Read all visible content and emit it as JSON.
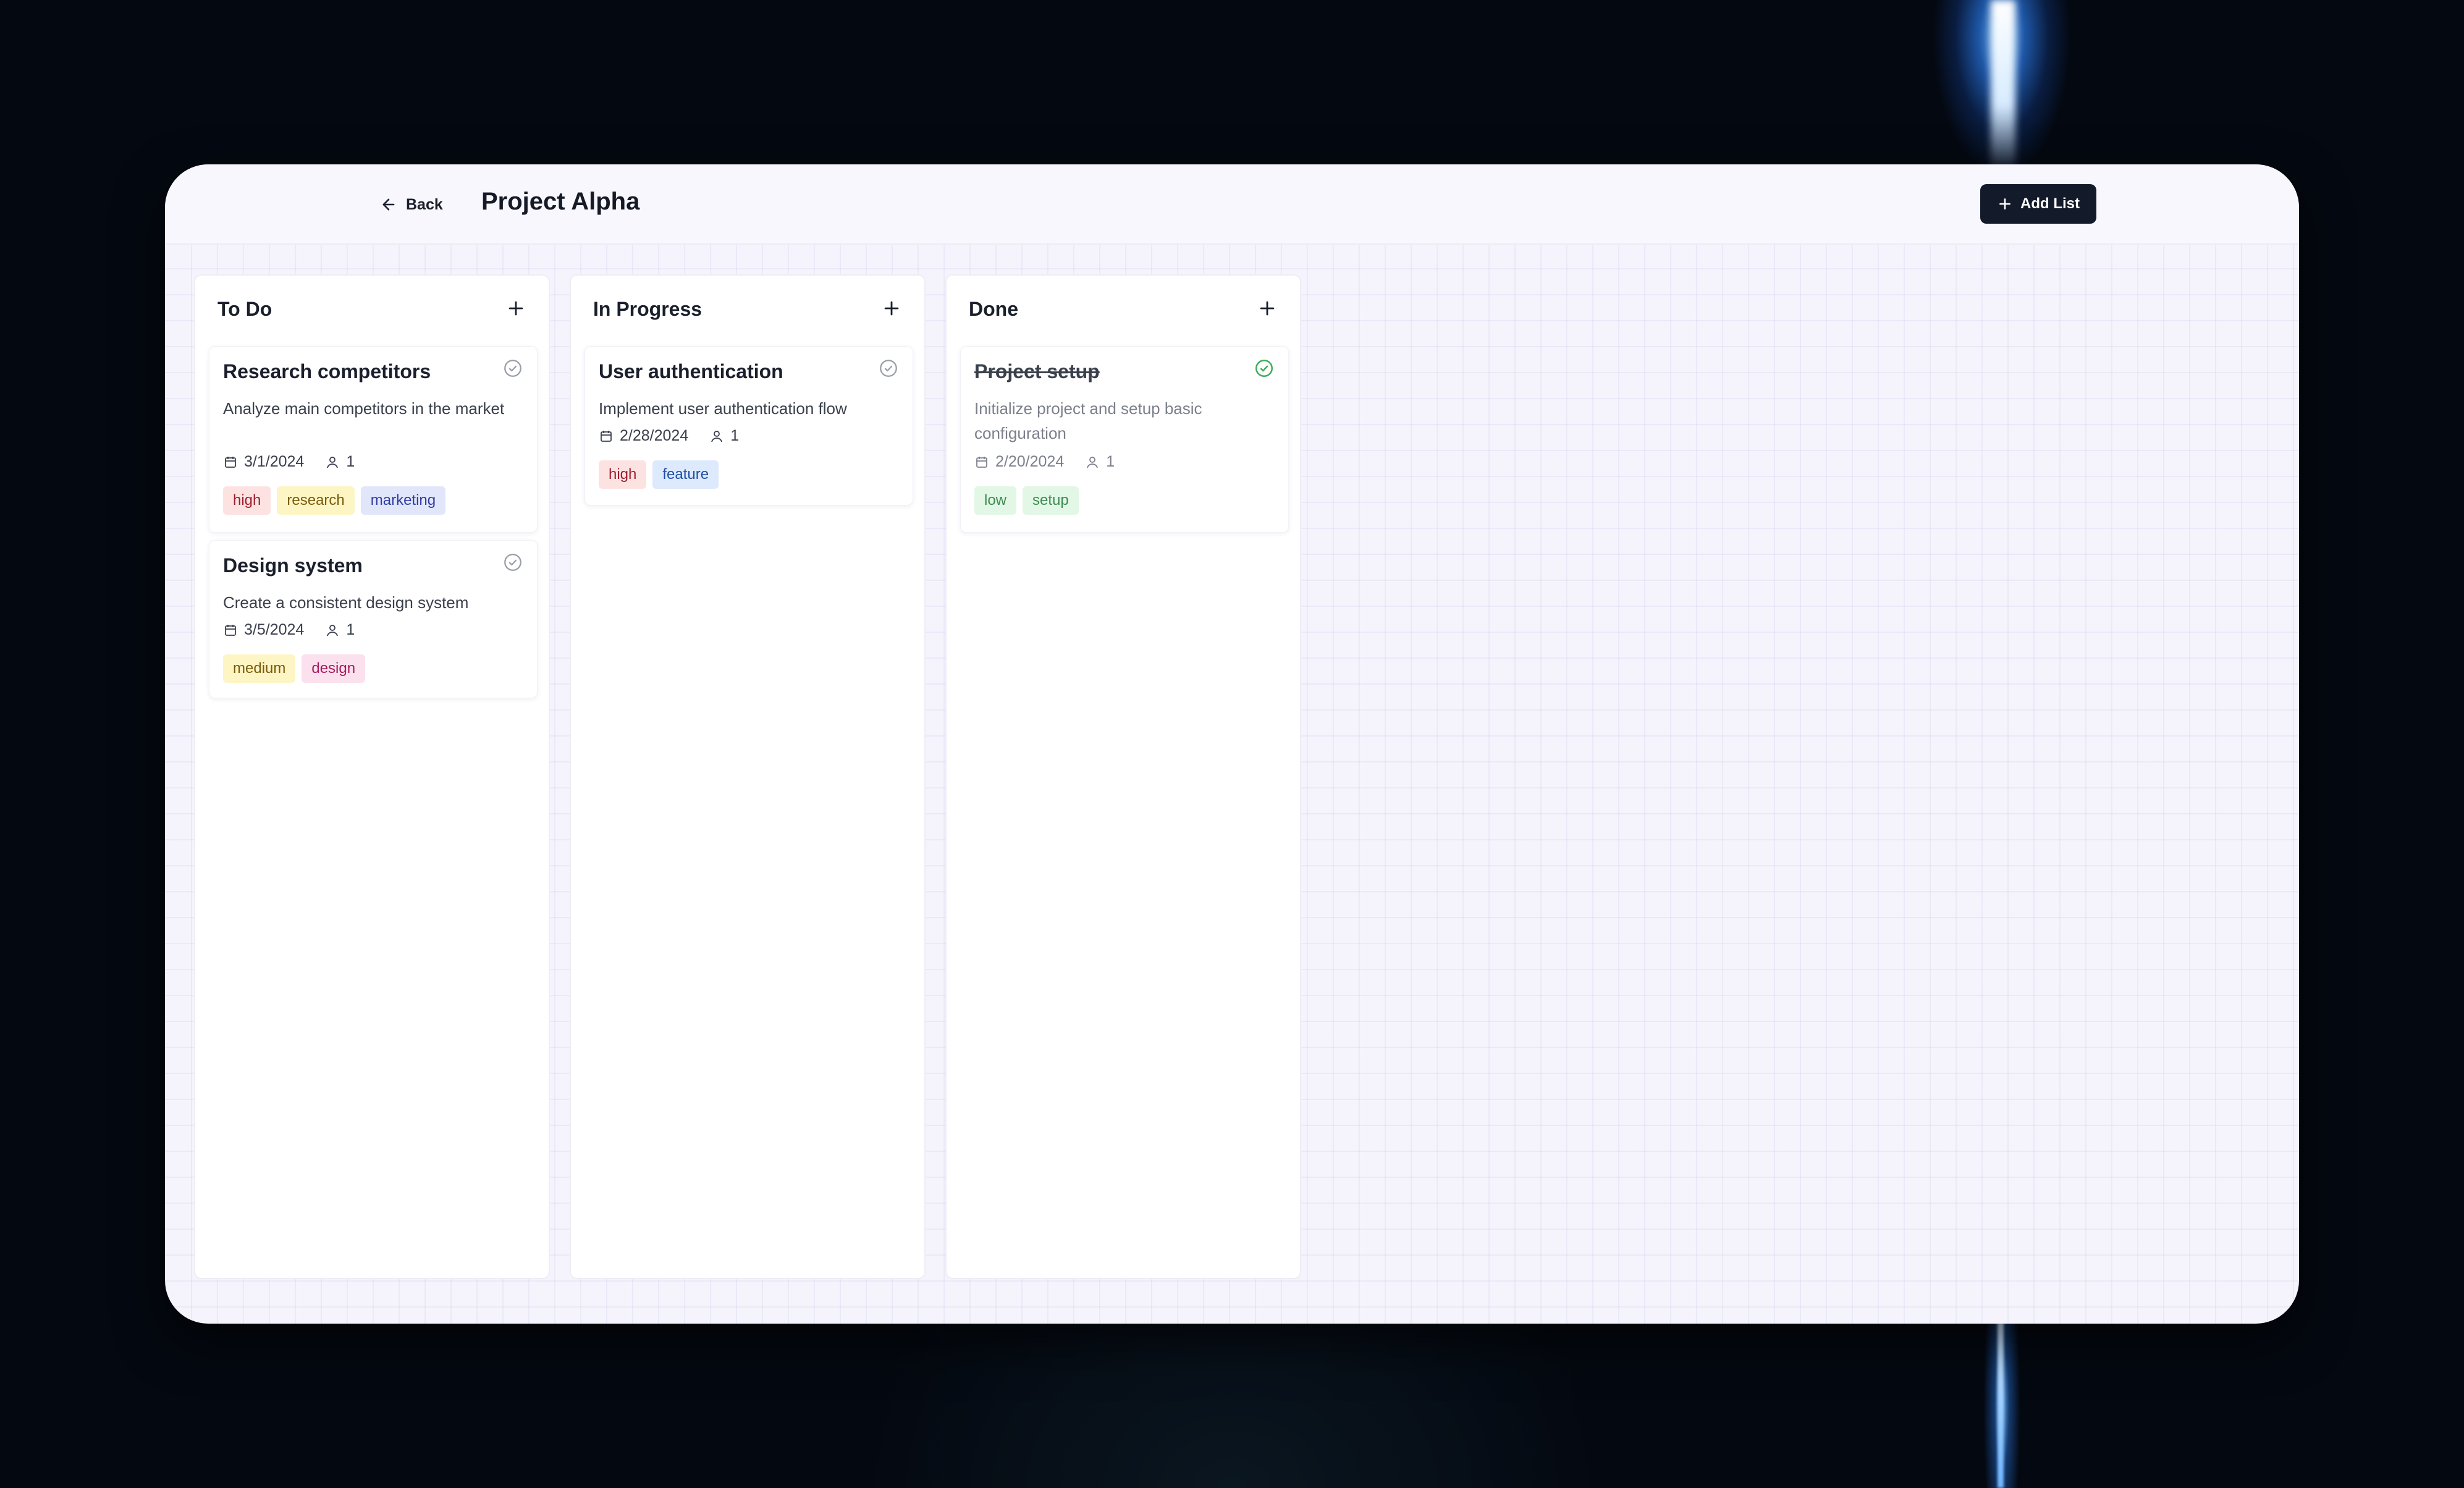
{
  "header": {
    "back_label": "Back",
    "title": "Project Alpha",
    "add_list_label": "Add List"
  },
  "columns": [
    {
      "title": "To Do",
      "cards": [
        {
          "title": "Research competitors",
          "description": "Analyze main competitors in the market",
          "date": "3/1/2024",
          "assignees": "1",
          "tags": [
            "high",
            "research",
            "marketing"
          ],
          "completed": false
        },
        {
          "title": "Design system",
          "description": "Create a consistent design system",
          "date": "3/5/2024",
          "assignees": "1",
          "tags": [
            "medium",
            "design"
          ],
          "completed": false
        }
      ]
    },
    {
      "title": "In Progress",
      "cards": [
        {
          "title": "User authentication",
          "description": "Implement user authentication flow",
          "date": "2/28/2024",
          "assignees": "1",
          "tags": [
            "high",
            "feature"
          ],
          "completed": false
        }
      ]
    },
    {
      "title": "Done",
      "cards": [
        {
          "title": "Project setup",
          "description": "Initialize project and setup basic configuration",
          "date": "2/20/2024",
          "assignees": "1",
          "tags": [
            "low",
            "setup"
          ],
          "completed": true
        }
      ]
    }
  ],
  "colors": {
    "primary_button": "#131a2a",
    "done_check": "#3fae5a",
    "pending_check": "#9a9ea8"
  },
  "icons": {
    "back": "arrow-left-icon",
    "add": "plus-icon",
    "check": "check-circle-icon",
    "date": "calendar-icon",
    "assignee": "user-icon"
  }
}
